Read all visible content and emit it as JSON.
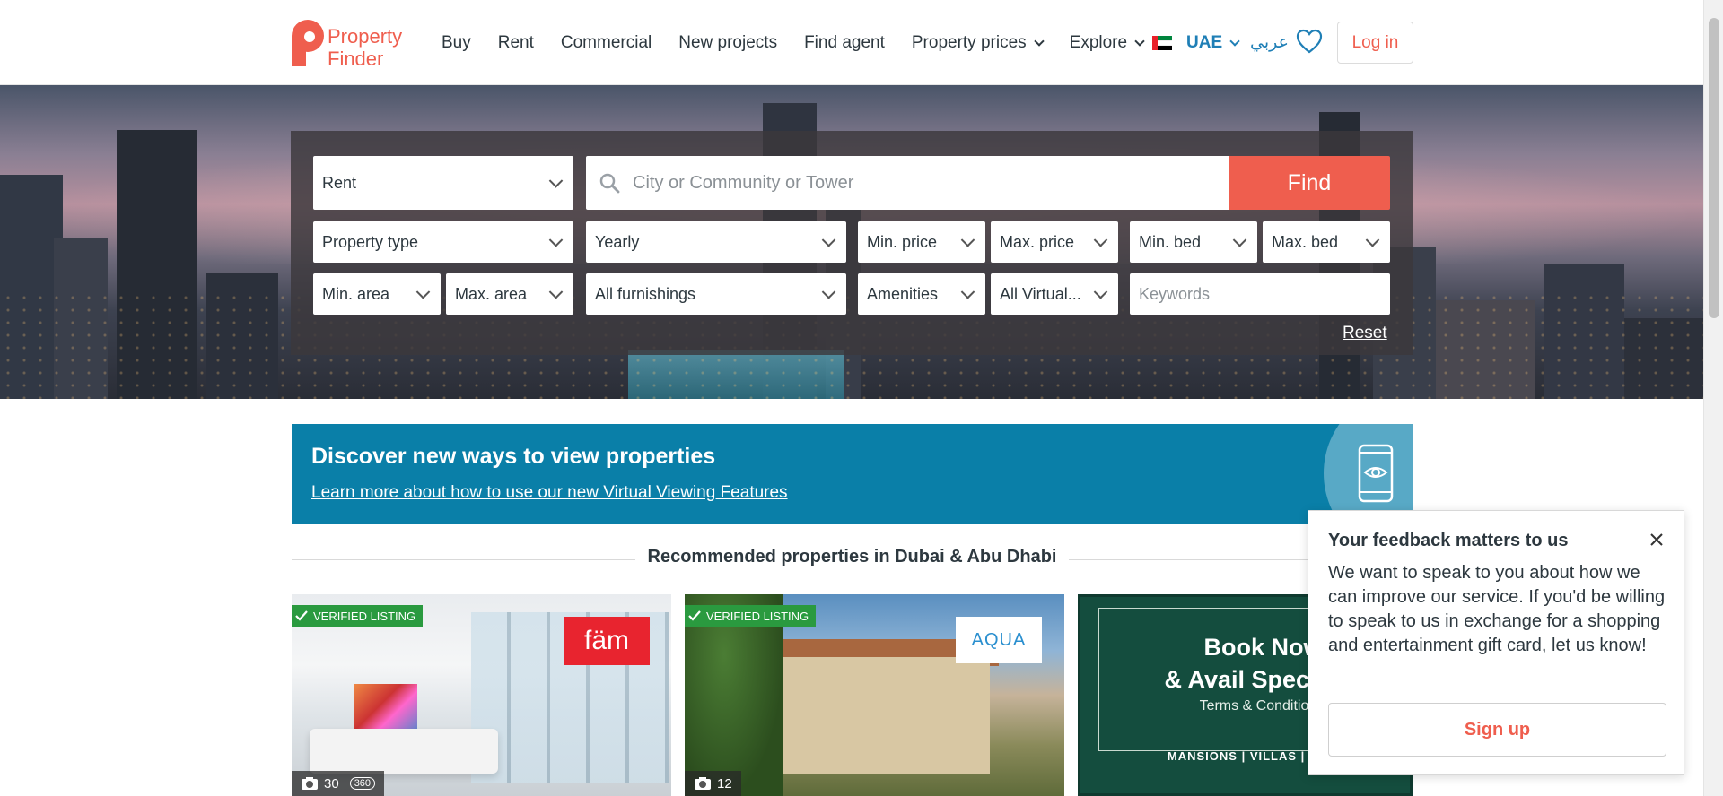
{
  "header": {
    "logo_text_line1": "Property",
    "logo_text_line2": "Finder",
    "nav": [
      {
        "label": "Buy",
        "has_dropdown": false
      },
      {
        "label": "Rent",
        "has_dropdown": false
      },
      {
        "label": "Commercial",
        "has_dropdown": false
      },
      {
        "label": "New projects",
        "has_dropdown": false
      },
      {
        "label": "Find agent",
        "has_dropdown": false
      },
      {
        "label": "Property prices",
        "has_dropdown": true
      },
      {
        "label": "Explore",
        "has_dropdown": true
      }
    ],
    "country": "UAE",
    "language": "عربي",
    "login_label": "Log in",
    "accent_color": "#ef5e4e",
    "link_color": "#1f7fb6"
  },
  "search": {
    "category": "Rent",
    "location_placeholder": "City or Community or Tower",
    "find_label": "Find",
    "property_type": "Property type",
    "rent_period": "Yearly",
    "min_price": "Min. price",
    "max_price": "Max. price",
    "min_bed": "Min. bed",
    "max_bed": "Max. bed",
    "min_area": "Min. area",
    "max_area": "Max. area",
    "furnishings": "All furnishings",
    "amenities": "Amenities",
    "virtual": "All Virtual...",
    "keywords_placeholder": "Keywords",
    "reset_label": "Reset"
  },
  "banner": {
    "title": "Discover new ways to view properties",
    "link": "Learn more about how to use our new Virtual Viewing Features",
    "color": "#0a7fa8"
  },
  "recommended": {
    "heading": "Recommended properties in Dubai & Abu Dhabi",
    "cards": [
      {
        "badge": "VERIFIED LISTING",
        "agency": "fäm",
        "photos": "30",
        "extra": "360"
      },
      {
        "badge": "VERIFIED LISTING",
        "agency": "AQUA",
        "photos": "12"
      }
    ],
    "ad": {
      "line1": "Book Now",
      "line2": "& Avail Special O",
      "sub": "Terms & Conditions Ap",
      "footer": "MANSIONS | VILLAS | RESIDENC"
    }
  },
  "feedback": {
    "title": "Your feedback matters to us",
    "body": "We want to speak to you about how we can improve our service. If you'd be willing to speak to us in exchange for a shopping and entertainment gift card, let us know!",
    "cta": "Sign up"
  }
}
